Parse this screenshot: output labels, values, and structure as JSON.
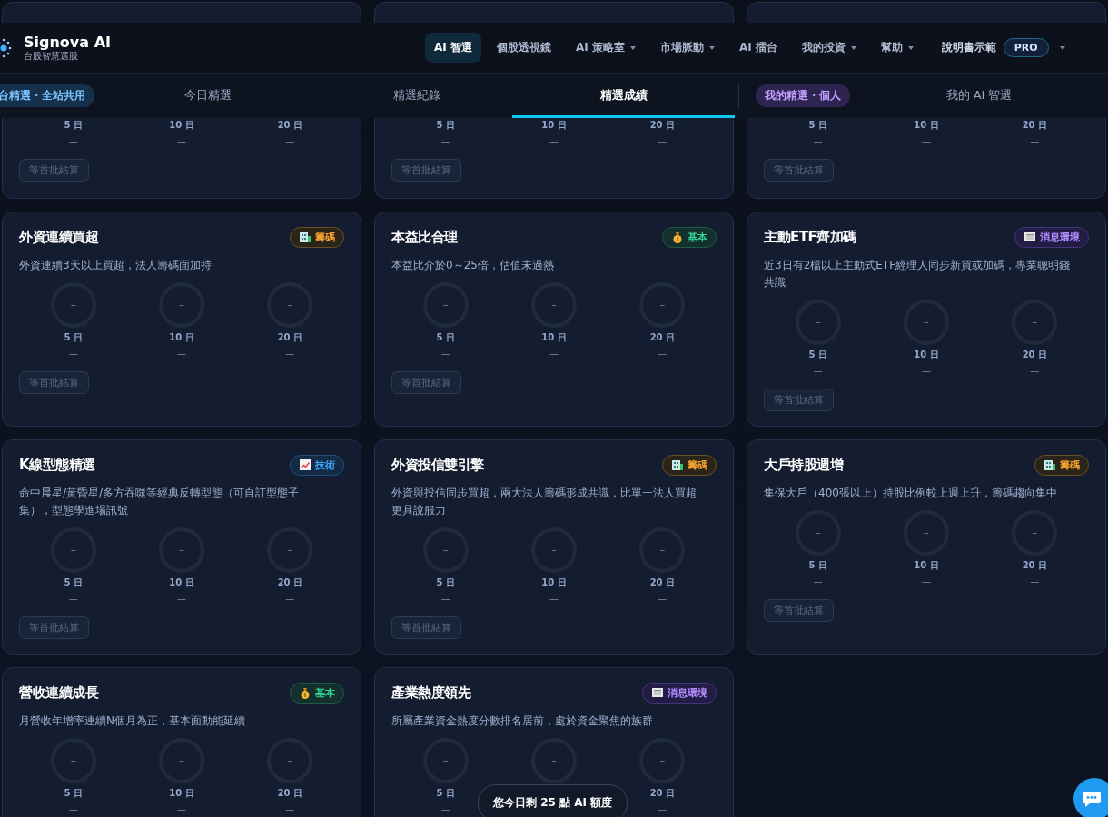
{
  "header": {
    "brand": "Signova AI",
    "tagline": "台股智慧選股",
    "nav": [
      {
        "label": "AI 智選",
        "selected": true,
        "dropdown": false
      },
      {
        "label": "個股透視鏡",
        "selected": false,
        "dropdown": false
      },
      {
        "label": "AI 策略室",
        "selected": false,
        "dropdown": true
      },
      {
        "label": "市場脈動",
        "selected": false,
        "dropdown": true
      },
      {
        "label": "AI 擂台",
        "selected": false,
        "dropdown": false
      },
      {
        "label": "我的投資",
        "selected": false,
        "dropdown": true
      },
      {
        "label": "幫助",
        "selected": false,
        "dropdown": true
      }
    ],
    "user": "說明書示範",
    "plan": "PRO"
  },
  "tab_bar": [
    {
      "kind": "platform",
      "label": "台精選・全站共用"
    },
    {
      "kind": "tab",
      "label": "今日精選",
      "selected": false
    },
    {
      "kind": "tab",
      "label": "精選紀錄",
      "selected": false
    },
    {
      "kind": "tab",
      "label": "精選成績",
      "selected": true
    },
    {
      "kind": "personal",
      "label": "我的精選・個人"
    },
    {
      "kind": "tab",
      "label": "我的 AI 智選",
      "selected": false
    }
  ],
  "cards": [
    {
      "kind": "covered",
      "gauges": [
        {
          "label": "5 日",
          "value": "—"
        },
        {
          "label": "10 日",
          "value": "—"
        },
        {
          "label": "20 日",
          "value": "—"
        }
      ],
      "button": {
        "label": "等首批結算",
        "disabled": true
      }
    },
    {
      "kind": "covered",
      "gauges": [
        {
          "label": "5 日",
          "value": "—"
        },
        {
          "label": "10 日",
          "value": "—"
        },
        {
          "label": "20 日",
          "value": "—"
        }
      ],
      "button": {
        "label": "等首批結算",
        "disabled": true
      }
    },
    {
      "kind": "covered",
      "gauges": [
        {
          "label": "5 日",
          "value": "—"
        },
        {
          "label": "10 日",
          "value": "—"
        },
        {
          "label": "20 日",
          "value": "—"
        }
      ],
      "button": {
        "label": "等首批結算",
        "disabled": true
      }
    },
    {
      "kind": "full",
      "title": "外資連續買超",
      "tag": {
        "kind": "chips",
        "label": "籌碼"
      },
      "description": "外資連續3天以上買超，法人籌碼面加持",
      "gauges": [
        {
          "center": "–",
          "label": "5 日",
          "value": "—"
        },
        {
          "center": "–",
          "label": "10 日",
          "value": "—"
        },
        {
          "center": "–",
          "label": "20 日",
          "value": "—"
        }
      ],
      "button": {
        "label": "等首批結算",
        "disabled": true
      }
    },
    {
      "kind": "full",
      "title": "本益比合理",
      "tag": {
        "kind": "fundamental",
        "label": "基本"
      },
      "description": "本益比介於0～25倍，估值未過熱",
      "gauges": [
        {
          "center": "–",
          "label": "5 日",
          "value": "—"
        },
        {
          "center": "–",
          "label": "10 日",
          "value": "—"
        },
        {
          "center": "–",
          "label": "20 日",
          "value": "—"
        }
      ],
      "button": {
        "label": "等首批結算",
        "disabled": true
      }
    },
    {
      "kind": "full",
      "title": "主動ETF齊加碼",
      "tag": {
        "kind": "news",
        "label": "消息環境"
      },
      "description": "近3日有2檔以上主動式ETF經理人同步新買或加碼，專業聰明錢共識",
      "gauges": [
        {
          "center": "–",
          "label": "5 日",
          "value": "—"
        },
        {
          "center": "–",
          "label": "10 日",
          "value": "—"
        },
        {
          "center": "–",
          "label": "20 日",
          "value": "—"
        }
      ],
      "button": {
        "label": "等首批結算",
        "disabled": true
      }
    },
    {
      "kind": "full",
      "title": "K線型態精選",
      "tag": {
        "kind": "technical",
        "label": "技術"
      },
      "description": "命中晨星/黃昏星/多方吞噬等經典反轉型態（可自訂型態子集），型態學進場訊號",
      "gauges": [
        {
          "center": "–",
          "label": "5 日",
          "value": "—"
        },
        {
          "center": "–",
          "label": "10 日",
          "value": "—"
        },
        {
          "center": "–",
          "label": "20 日",
          "value": "—"
        }
      ],
      "button": {
        "label": "等首批結算",
        "disabled": true
      }
    },
    {
      "kind": "full",
      "title": "外資投信雙引擎",
      "tag": {
        "kind": "chips",
        "label": "籌碼"
      },
      "description": "外資與投信同步買超，兩大法人籌碼形成共識，比單一法人買超更具說服力",
      "gauges": [
        {
          "center": "–",
          "label": "5 日",
          "value": "—"
        },
        {
          "center": "–",
          "label": "10 日",
          "value": "—"
        },
        {
          "center": "–",
          "label": "20 日",
          "value": "—"
        }
      ],
      "button": {
        "label": "等首批結算",
        "disabled": true
      }
    },
    {
      "kind": "full",
      "title": "大戶持股週增",
      "tag": {
        "kind": "chips",
        "label": "籌碼"
      },
      "description": "集保大戶（400張以上）持股比例較上週上升，籌碼趨向集中",
      "gauges": [
        {
          "center": "–",
          "label": "5 日",
          "value": "—"
        },
        {
          "center": "–",
          "label": "10 日",
          "value": "—"
        },
        {
          "center": "–",
          "label": "20 日",
          "value": "—"
        }
      ],
      "button": {
        "label": "等首批結算",
        "disabled": true
      }
    },
    {
      "kind": "full",
      "title": "營收連續成長",
      "tag": {
        "kind": "fundamental",
        "label": "基本"
      },
      "description": "月營收年增率連續N個月為正，基本面動能延續",
      "gauges": [
        {
          "center": "–",
          "label": "5 日",
          "value": "—"
        },
        {
          "center": "–",
          "label": "10 日",
          "value": "—"
        },
        {
          "center": "–",
          "label": "20 日",
          "value": "—"
        }
      ]
    },
    {
      "kind": "full",
      "title": "產業熱度領先",
      "tag": {
        "kind": "news",
        "label": "消息環境"
      },
      "description": "所屬產業資金熱度分數排名居前，處於資金聚焦的族群",
      "gauges": [
        {
          "center": "–",
          "label": "5 日",
          "value": "—"
        },
        {
          "center": "–"
        },
        {
          "center": "–",
          "label": "20 日",
          "value": "—"
        }
      ]
    }
  ],
  "quota_notice": "您今日剩 25 點 AI 額度"
}
